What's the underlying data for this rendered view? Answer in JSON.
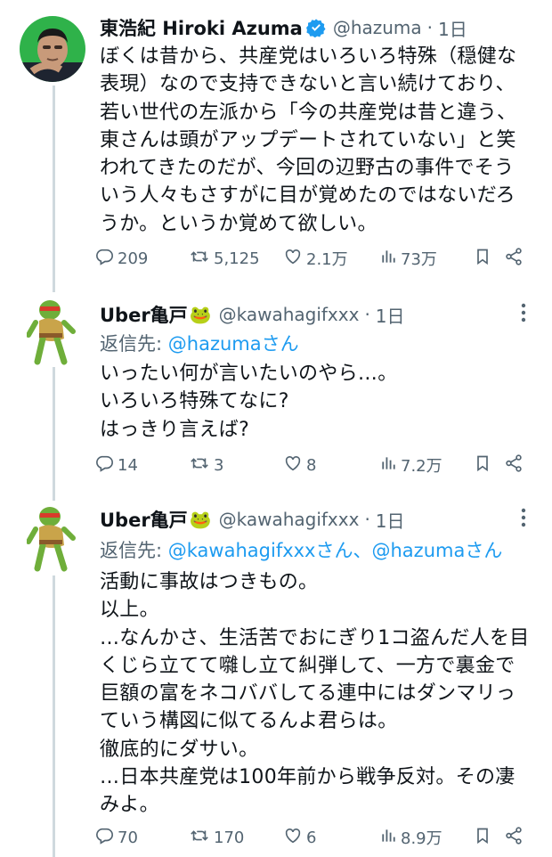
{
  "tweets": [
    {
      "name": "東浩紀 Hiroki Azuma",
      "verified": true,
      "handle": "@hazuma",
      "time": "1日",
      "reply_prefix": "",
      "reply_mentions": "",
      "text": "ぼくは昔から、共産党はいろいろ特殊（穏健な\n表現）なので支持できないと言い続けており、\n若い世代の左派から「今の共産党は昔と違う、\n東さんは頭がアップデートされていない」と笑\nわれてきたのだが、今回の辺野古の事件でそう\nいう人々もさすがに目が覚めたのではないだろ\nうか。というか覚めて欲しい。",
      "replies": "209",
      "retweets": "5,125",
      "likes": "2.1万",
      "views": "73万"
    },
    {
      "name": "Uber亀戸",
      "name_emoji": "🐸",
      "verified": false,
      "handle": "@kawahagifxxx",
      "time": "1日",
      "reply_prefix": "返信先: ",
      "reply_mentions": "@hazumaさん",
      "text": "いったい何が言いたいのやら…。\nいろいろ特殊てなに?\nはっきり言えば?",
      "replies": "14",
      "retweets": "3",
      "likes": "8",
      "views": "7.2万"
    },
    {
      "name": "Uber亀戸",
      "name_emoji": "🐸",
      "verified": false,
      "handle": "@kawahagifxxx",
      "time": "1日",
      "reply_prefix": "返信先: ",
      "reply_mentions": "@kawahagifxxxさん、@hazumaさん",
      "text": "活動に事故はつきもの。\n以上。\n…なんかさ、生活苦でおにぎり1コ盗んだ人を目\nくじら立てて囃し立て糾弾して、一方で裏金で\n巨額の富をネコババしてる連中にはダンマリっ\nていう構図に似てるんよ君らは。\n徹底的にダサい。\n…日本共産党は100年前から戦争反対。その凄\nみよ。",
      "replies": "70",
      "retweets": "170",
      "likes": "6",
      "views": "8.9万"
    }
  ],
  "separator": "·",
  "colors": {
    "text": "#0f1419",
    "muted": "#536471",
    "link": "#1d9bf0",
    "thread_line": "#cfd9de"
  },
  "icons": [
    "verified-badge-icon",
    "more-icon",
    "reply-icon",
    "retweet-icon",
    "like-icon",
    "views-icon",
    "bookmark-icon",
    "share-icon"
  ]
}
